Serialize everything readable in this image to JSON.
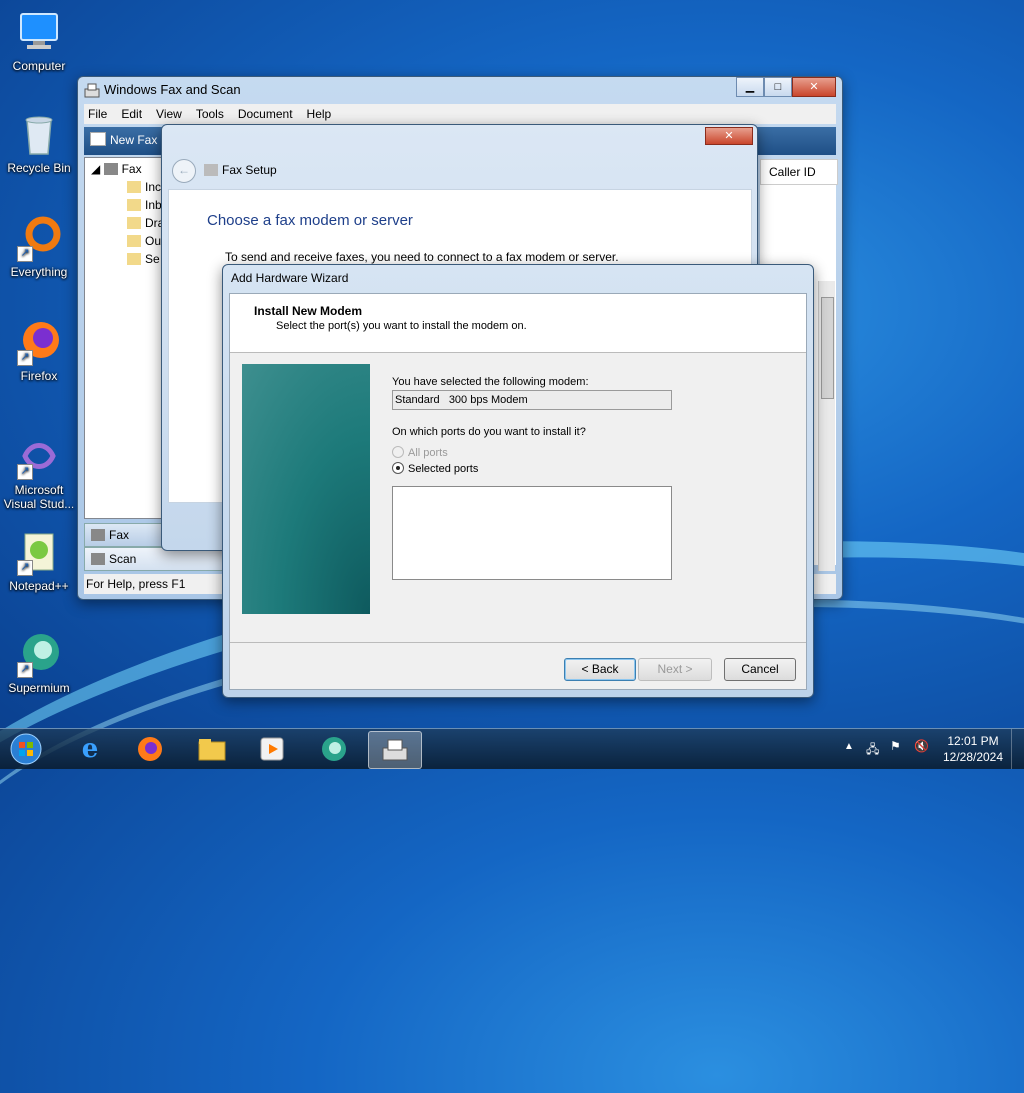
{
  "desktop": {
    "icons": [
      {
        "label": "Computer"
      },
      {
        "label": "Recycle Bin"
      },
      {
        "label": "Everything"
      },
      {
        "label": "Firefox"
      },
      {
        "label": "Microsoft Visual Stud..."
      },
      {
        "label": "Notepad++"
      },
      {
        "label": "Supermium"
      }
    ]
  },
  "fax_window": {
    "title": "Windows Fax and Scan",
    "menu": [
      "File",
      "Edit",
      "View",
      "Tools",
      "Document",
      "Help"
    ],
    "toolbar_new_fax": "New Fax",
    "tree": {
      "root": "Fax",
      "children": [
        "Inc",
        "Inb",
        "Dra",
        "Ou",
        "Se"
      ]
    },
    "column_caller_id": "Caller ID",
    "nav_fax": "Fax",
    "nav_scan": "Scan",
    "status": "For Help, press F1"
  },
  "fax_setup": {
    "title": "Fax Setup",
    "heading": "Choose a fax modem or server",
    "instruction": "To send and receive faxes, you need to connect to a fax modem or server."
  },
  "wizard": {
    "title": "Add Hardware Wizard",
    "header_title": "Install New Modem",
    "header_subtitle": "Select the port(s) you want to install the modem on.",
    "selected_modem_label": "You have selected the following modem:",
    "selected_modem_value": "Standard   300 bps Modem",
    "ports_question": "On which ports do you want to install it?",
    "option_all": "All ports",
    "option_selected": "Selected ports",
    "back_button": "< Back",
    "next_button": "Next >",
    "cancel_button": "Cancel"
  },
  "taskbar": {
    "time": "12:01 PM",
    "date": "12/28/2024"
  }
}
